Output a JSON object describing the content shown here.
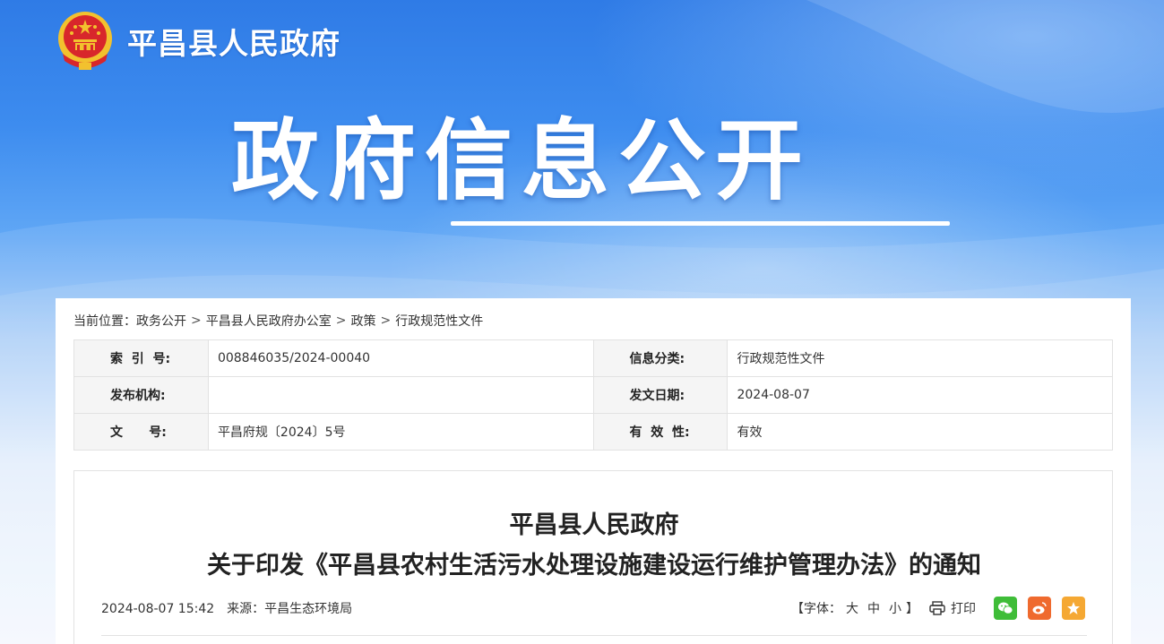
{
  "header": {
    "site_title": "平昌县人民政府",
    "hero_title": "政府信息公开"
  },
  "breadcrumb": {
    "prefix": "当前位置：",
    "items": [
      "政务公开",
      "平昌县人民政府办公室",
      "政策",
      "行政规范性文件"
    ],
    "separator": ">"
  },
  "meta": {
    "rows": [
      {
        "label1": "索  引  号:",
        "value1": "008846035/2024-00040",
        "label2": "信息分类:",
        "value2": "行政规范性文件"
      },
      {
        "label1": "发布机构:",
        "value1": "",
        "label2": "发文日期:",
        "value2": "2024-08-07"
      },
      {
        "label1": "文      号:",
        "value1": "平昌府规〔2024〕5号",
        "label2": "有  效  性:",
        "value2": "有效"
      }
    ]
  },
  "article": {
    "title_line1": "平昌县人民政府",
    "title_line2": "关于印发《平昌县农村生活污水处理设施建设运行维护管理办法》的通知",
    "datetime": "2024-08-07 15:42",
    "source_label": "来源：",
    "source": "平昌生态环境局"
  },
  "tools": {
    "font_prefix": "【字体：",
    "font_large": "大",
    "font_medium": "中",
    "font_small": "小",
    "font_suffix": "】",
    "print_label": "打印"
  },
  "colors": {
    "banner_blue": "#2f7be6",
    "wechat": "#3fbd38",
    "weibo": "#ef6a2e",
    "favorite": "#f5a833"
  }
}
